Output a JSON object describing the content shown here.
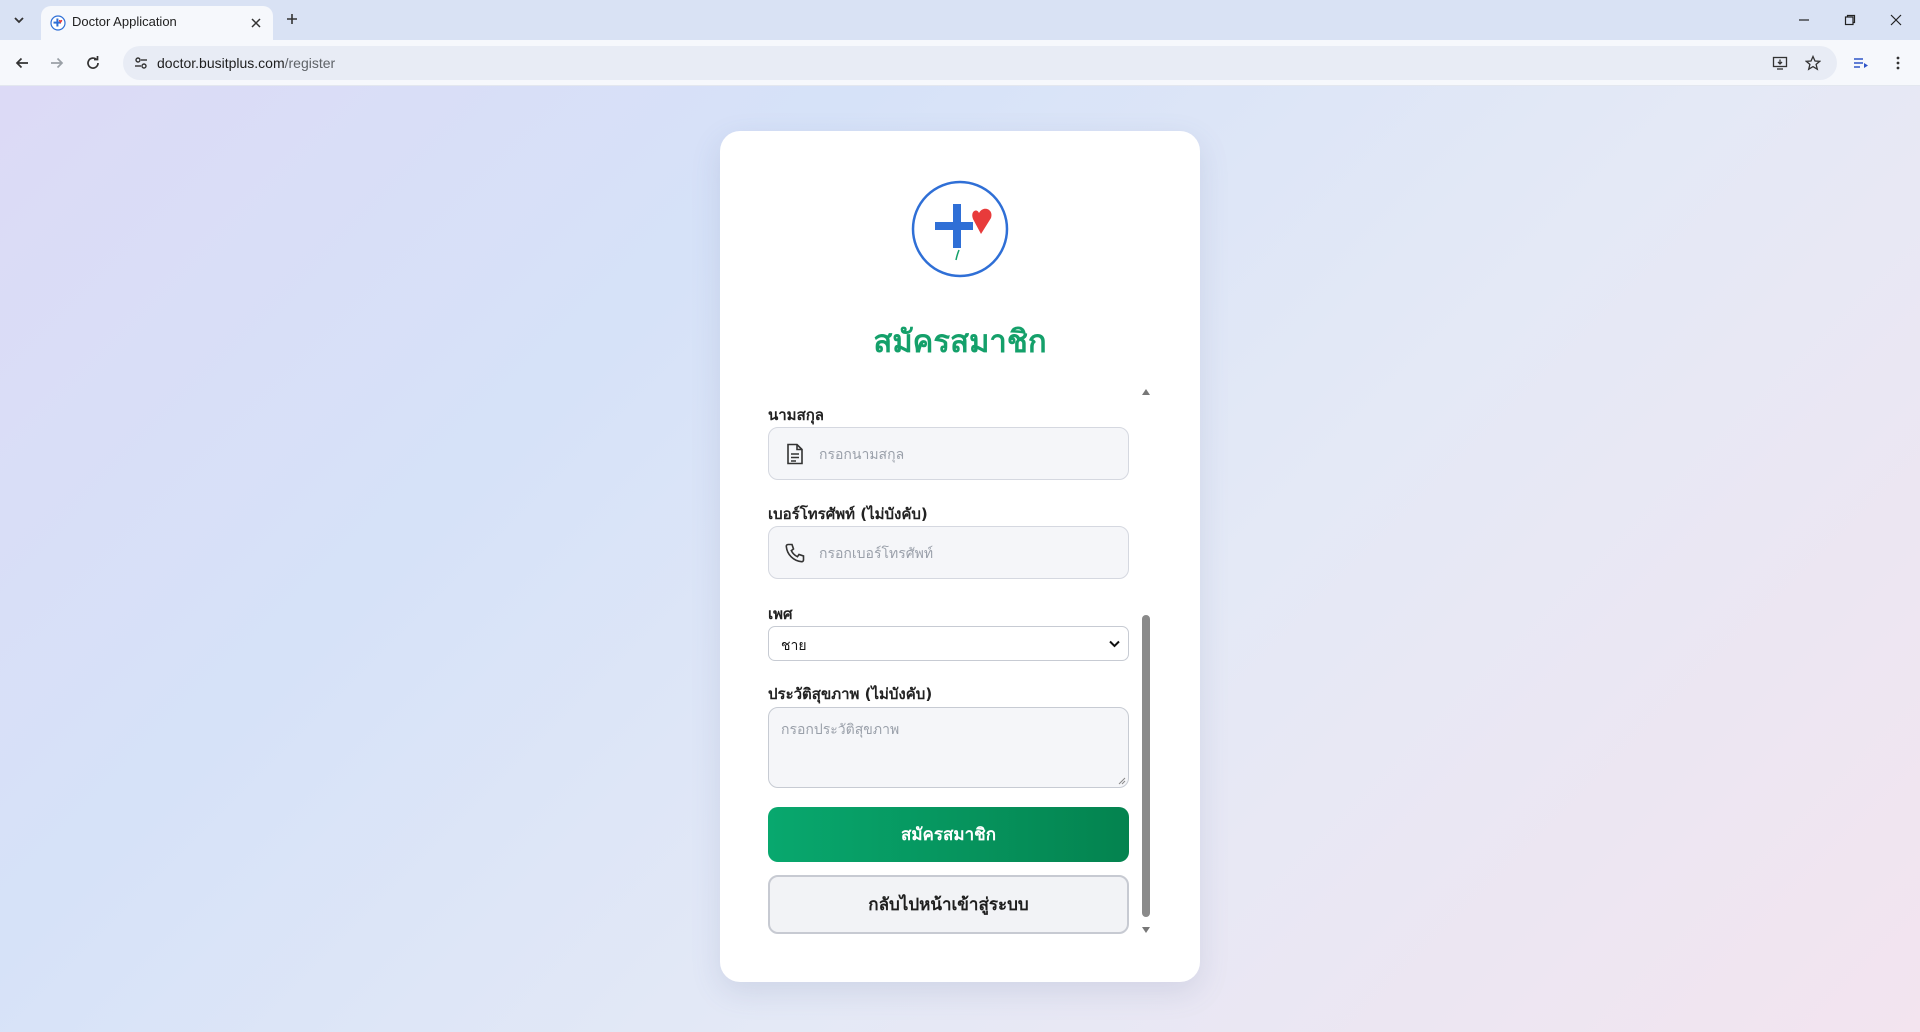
{
  "browser": {
    "tab_title": "Doctor Application",
    "url_host": "doctor.busitplus.com",
    "url_path": "/register"
  },
  "page": {
    "title": "สมัครสมาชิก",
    "fields": {
      "lastname": {
        "label": "นามสกุล",
        "placeholder": "กรอกนามสกุล",
        "icon": "document-icon"
      },
      "phone": {
        "label": "เบอร์โทรศัพท์ (ไม่บังคับ)",
        "placeholder": "กรอกเบอร์โทรศัพท์",
        "icon": "phone-icon"
      },
      "gender": {
        "label": "เพศ",
        "value": "ชาย"
      },
      "health_history": {
        "label": "ประวัติสุขภาพ (ไม่บังคับ)",
        "placeholder": "กรอกประวัติสุขภาพ"
      }
    },
    "buttons": {
      "register": "สมัครสมาชิก",
      "back_to_login": "กลับไปหน้าเข้าสู่ระบบ"
    }
  },
  "colors": {
    "brand_green": "#14a06a",
    "logo_blue": "#2f6fd6",
    "logo_heart": "#e83b3b"
  }
}
